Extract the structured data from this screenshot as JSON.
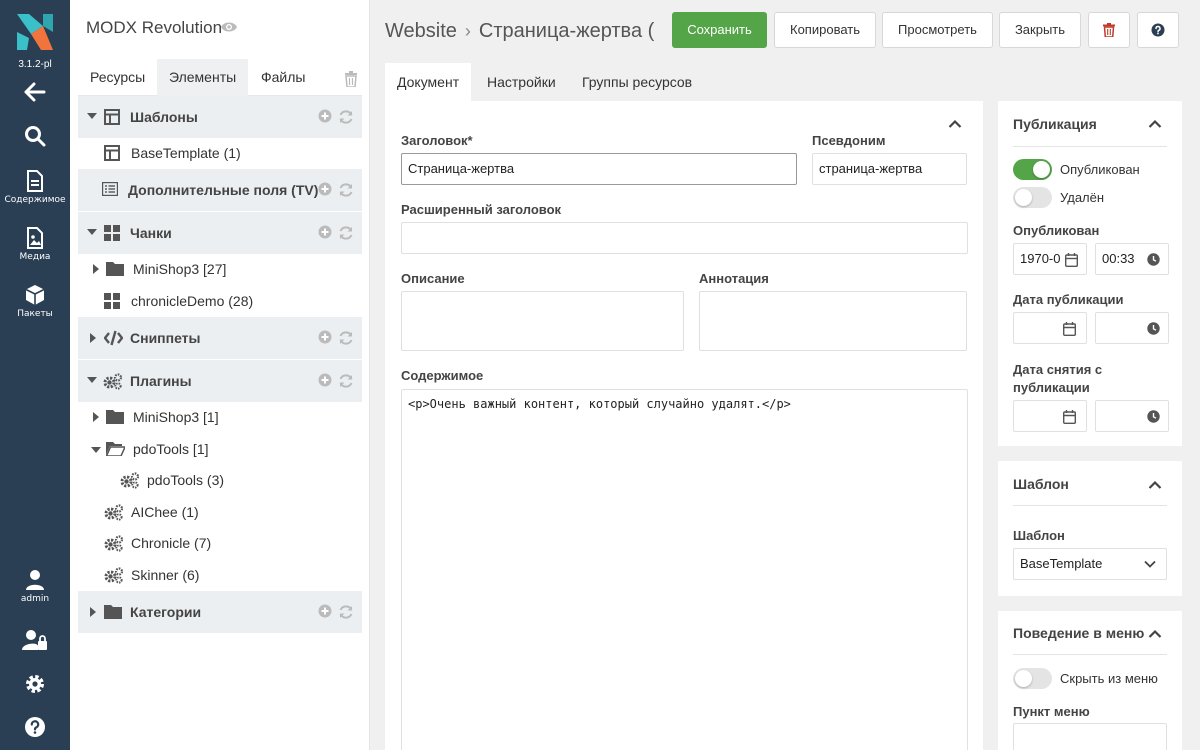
{
  "app": {
    "version": "3.1.2-pl",
    "rail": {
      "content_label": "Содержимое",
      "media_label": "Медиа",
      "packages_label": "Пакеты",
      "user_label": "admin"
    }
  },
  "tree": {
    "site_name": "MODX Revolution",
    "tabs": [
      "Ресурсы",
      "Элементы",
      "Файлы"
    ],
    "templates": {
      "label": "Шаблоны",
      "items": [
        "BaseTemplate (1)"
      ]
    },
    "tvs": {
      "label": "Дополнительные поля (TV)"
    },
    "chunks": {
      "label": "Чанки",
      "items": [
        "MiniShop3 [27]",
        "chronicleDemo (28)"
      ]
    },
    "snippets": {
      "label": "Сниппеты"
    },
    "plugins": {
      "label": "Плагины",
      "items": [
        "MiniShop3 [1]",
        "pdoTools [1]",
        "pdoTools (3)",
        "AIChee (1)",
        "Chronicle (7)",
        "Skinner (6)"
      ]
    },
    "categories": {
      "label": "Категории"
    }
  },
  "header": {
    "crumb_root": "Website",
    "crumb_page": "Страница-жертва (",
    "buttons": {
      "save": "Сохранить",
      "copy": "Копировать",
      "view": "Просмотреть",
      "close": "Закрыть"
    }
  },
  "tabs": [
    "Документ",
    "Настройки",
    "Группы ресурсов"
  ],
  "document": {
    "title_label": "Заголовок*",
    "title_value": "Страница-жертва",
    "alias_label": "Псевдоним",
    "alias_value": "страница-жертва",
    "longtitle_label": "Расширенный заголовок",
    "description_label": "Описание",
    "introtext_label": "Аннотация",
    "content_label": "Содержимое",
    "content_value": "<p>Очень важный контент, который случайно удалят.</p>"
  },
  "publication": {
    "title": "Публикация",
    "published_toggle": "Опубликован",
    "published_on": true,
    "deleted_toggle": "Удалён",
    "deleted_on": false,
    "publishedon_label": "Опубликован",
    "publishedon_date": "1970-0",
    "publishedon_time": "00:33",
    "pub_date_label": "Дата публикации",
    "unpub_date_label": "Дата снятия с публикации"
  },
  "template_panel": {
    "title": "Шаблон",
    "field_label": "Шаблон",
    "selected": "BaseTemplate"
  },
  "menu_panel": {
    "title": "Поведение в меню",
    "hide_toggle": "Скрыть из меню",
    "hide_on": false,
    "menu_item_label": "Пункт меню"
  },
  "colors": {
    "rail": "#2a3f54",
    "accent": "#53a548",
    "logo_teal": "#3ac0c8",
    "logo_orange": "#f0743c"
  }
}
